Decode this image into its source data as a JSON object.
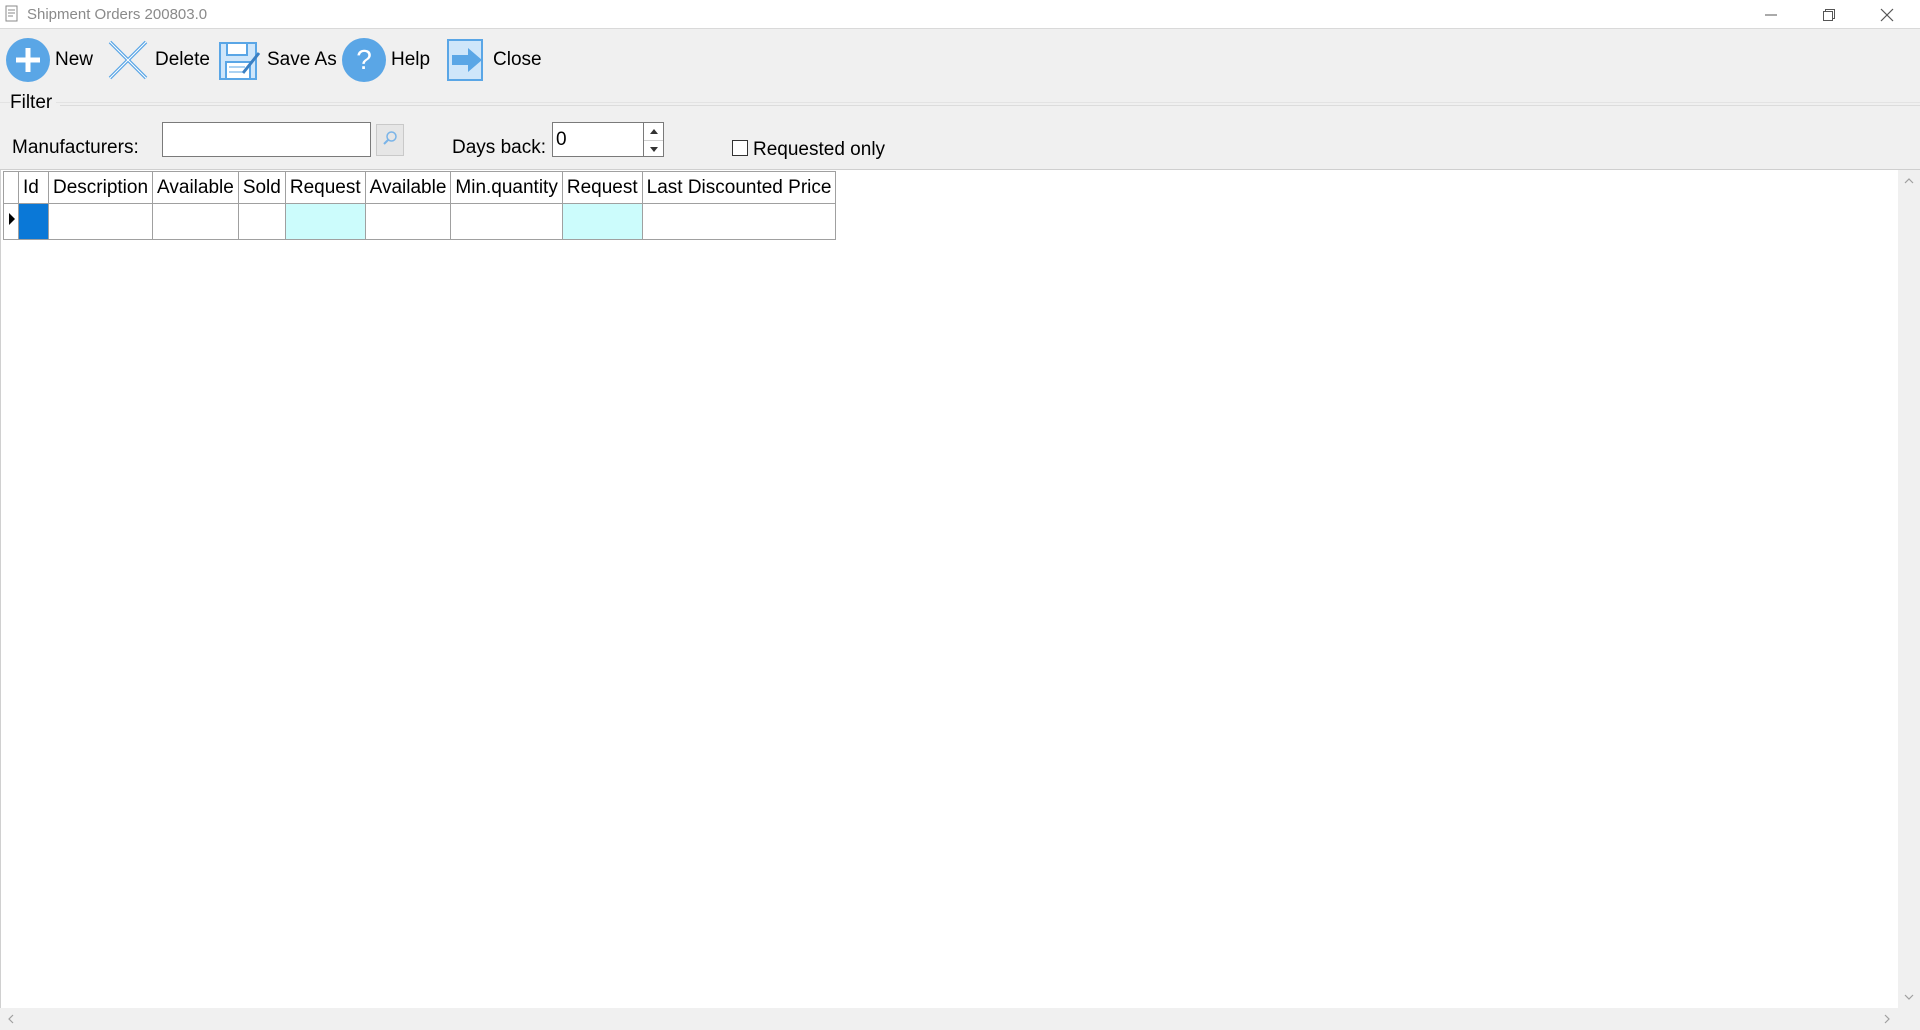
{
  "window": {
    "title": "Shipment Orders 200803.0"
  },
  "toolbar": {
    "new_label": "New",
    "delete_label": "Delete",
    "save_as_label": "Save As",
    "help_label": "Help",
    "close_label": "Close"
  },
  "filter": {
    "legend": "Filter",
    "manufacturers_label": "Manufacturers:",
    "manufacturers_value": "",
    "days_back_label": "Days back:",
    "days_back_value": "0",
    "requested_only_label": "Requested only",
    "requested_only_checked": false
  },
  "grid": {
    "columns": [
      "Id",
      "Description",
      "Available",
      "Sold",
      "Request",
      "Available",
      "Min.quantity",
      "Request",
      "Last Discounted Price"
    ],
    "rows": [
      [
        "",
        "",
        "",
        "",
        "",
        "",
        "",
        "",
        ""
      ]
    ]
  },
  "colors": {
    "selection": "#0a78d7",
    "request_cell": "#ccfcfc",
    "toolbar_icon": "#5aa6e6"
  },
  "icons": {
    "new": "plus-circle-icon",
    "delete": "x-icon",
    "save_as": "floppy-edit-icon",
    "help": "question-circle-icon",
    "close": "exit-arrow-icon",
    "lookup": "search-icon"
  }
}
